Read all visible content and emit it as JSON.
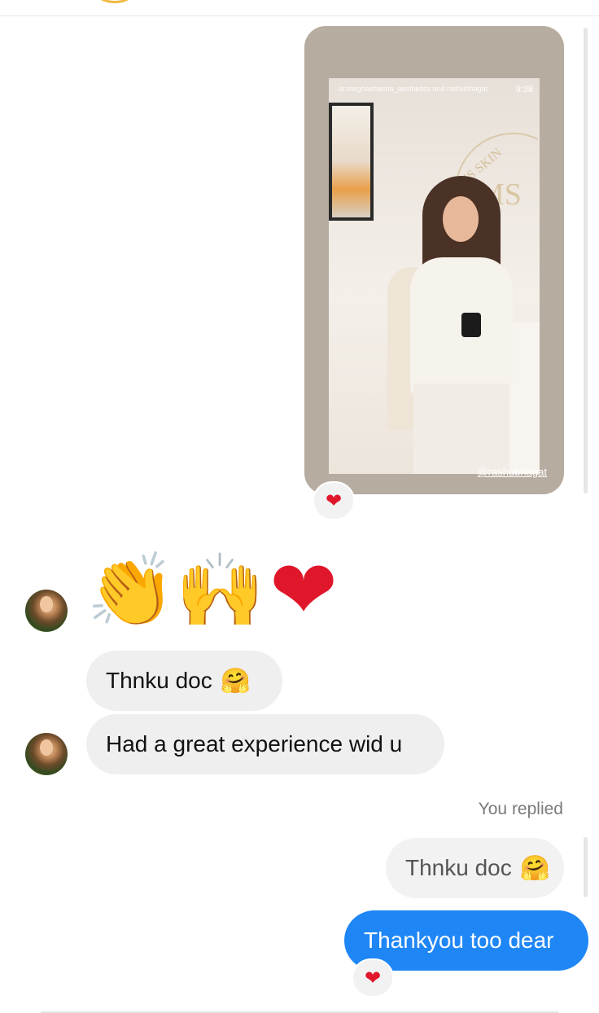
{
  "story": {
    "header_text": "dr.meghasharma_aesthetics and rashubhagat",
    "time": "9:38",
    "tag": "@rashubhagat",
    "reaction": "❤"
  },
  "messages": {
    "emoji_reaction": {
      "clap": "👏",
      "raised_hands": "🙌",
      "heart": "❤"
    },
    "received_1": {
      "text": "Thnku doc",
      "emoji": "🤗"
    },
    "received_2": {
      "text": "Had a great experience wid u"
    },
    "you_replied_label": "You replied",
    "quoted_reply": {
      "text": "Thnku doc",
      "emoji": "🤗"
    },
    "sent": {
      "text": "Thankyou too dear",
      "reaction": "❤"
    }
  },
  "colors": {
    "sent_bubble": "#1f86f6",
    "received_bubble": "#efefef",
    "heart": "#e0162b",
    "story_card": "#b6aca0"
  }
}
